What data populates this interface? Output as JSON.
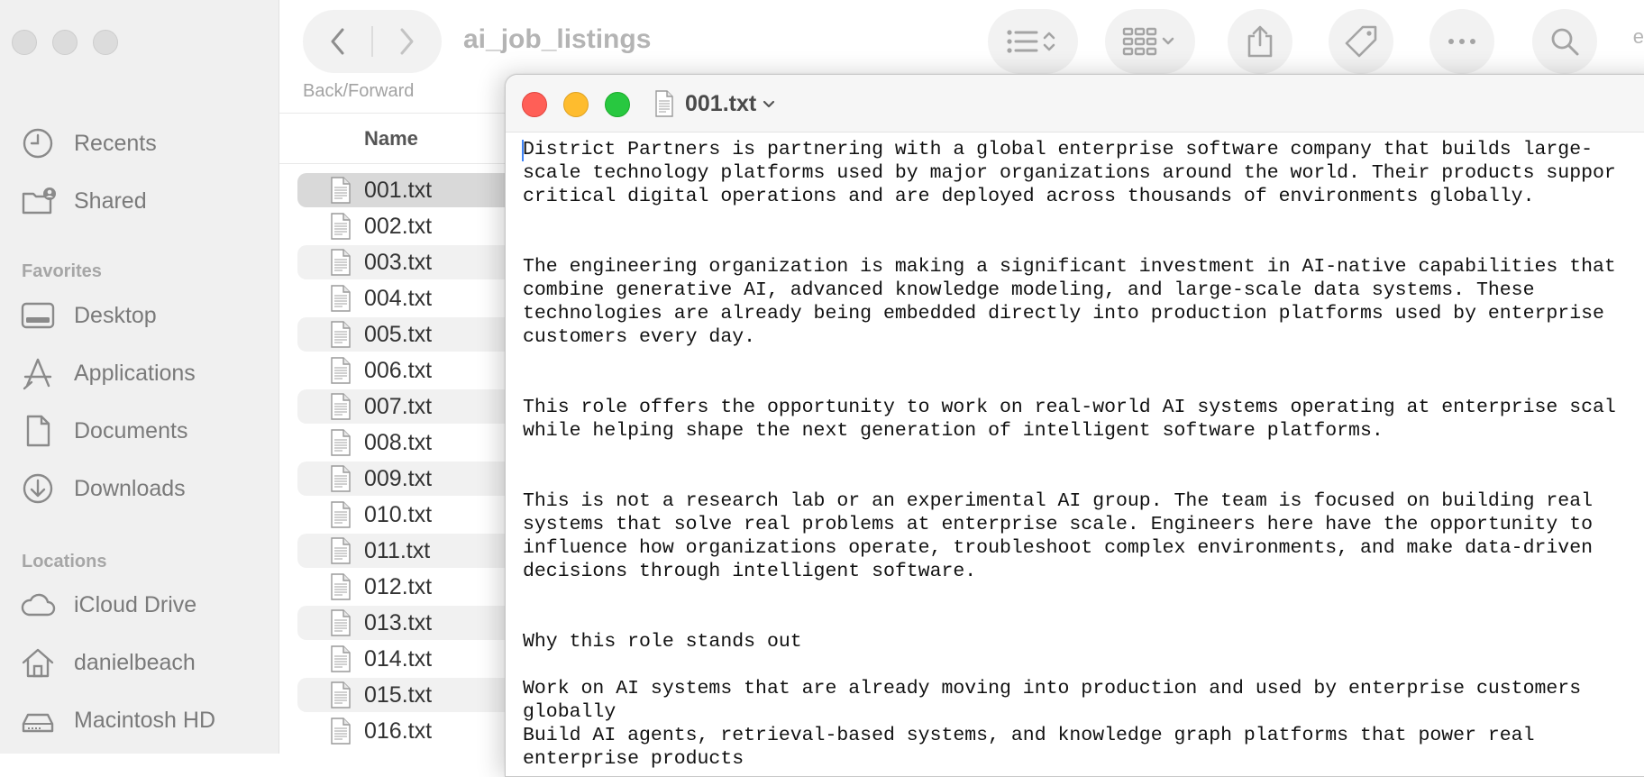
{
  "finder": {
    "title": "ai_job_listings",
    "nav_caption": "Back/Forward",
    "toolbar_cut_text": "e",
    "column_name": "Name",
    "sidebar": {
      "favorites_label": "Favorites",
      "locations_label": "Locations",
      "top_items": [
        {
          "label": "Recents",
          "icon": "clock-icon"
        },
        {
          "label": "Shared",
          "icon": "shared-folder-icon"
        }
      ],
      "favorites": [
        {
          "label": "Desktop",
          "icon": "desktop-icon"
        },
        {
          "label": "Applications",
          "icon": "applications-icon"
        },
        {
          "label": "Documents",
          "icon": "document-icon"
        },
        {
          "label": "Downloads",
          "icon": "download-icon"
        }
      ],
      "locations": [
        {
          "label": "iCloud Drive",
          "icon": "cloud-icon"
        },
        {
          "label": "danielbeach",
          "icon": "home-icon"
        },
        {
          "label": "Macintosh HD",
          "icon": "disk-icon"
        }
      ]
    },
    "files": [
      "001.txt",
      "002.txt",
      "003.txt",
      "004.txt",
      "005.txt",
      "006.txt",
      "007.txt",
      "008.txt",
      "009.txt",
      "010.txt",
      "011.txt",
      "012.txt",
      "013.txt",
      "014.txt",
      "015.txt",
      "016.txt"
    ],
    "selected_file": "001.txt"
  },
  "editor": {
    "title": "001.txt",
    "lines": [
      "District Partners is partnering with a global enterprise software company that builds large-",
      "scale technology platforms used by major organizations around the world. Their products suppor",
      "critical digital operations and are deployed across thousands of environments globally.",
      "",
      "",
      "The engineering organization is making a significant investment in AI-native capabilities that",
      "combine generative AI, advanced knowledge modeling, and large-scale data systems. These",
      "technologies are already being embedded directly into production platforms used by enterprise",
      "customers every day.",
      "",
      "",
      "This role offers the opportunity to work on real-world AI systems operating at enterprise scal",
      "while helping shape the next generation of intelligent software platforms.",
      "",
      "",
      "This is not a research lab or an experimental AI group. The team is focused on building real",
      "systems that solve real problems at enterprise scale. Engineers here have the opportunity to",
      "influence how organizations operate, troubleshoot complex environments, and make data-driven",
      "decisions through intelligent software.",
      "",
      "",
      "Why this role stands out",
      "",
      "Work on AI systems that are already moving into production and used by enterprise customers",
      "globally",
      "Build AI agents, retrieval-based systems, and knowledge graph platforms that power real",
      "enterprise products"
    ]
  },
  "colors": {
    "close": "#ff5f57",
    "minimize": "#febc2e",
    "zoom": "#28c840",
    "caret": "#3f84f7"
  }
}
